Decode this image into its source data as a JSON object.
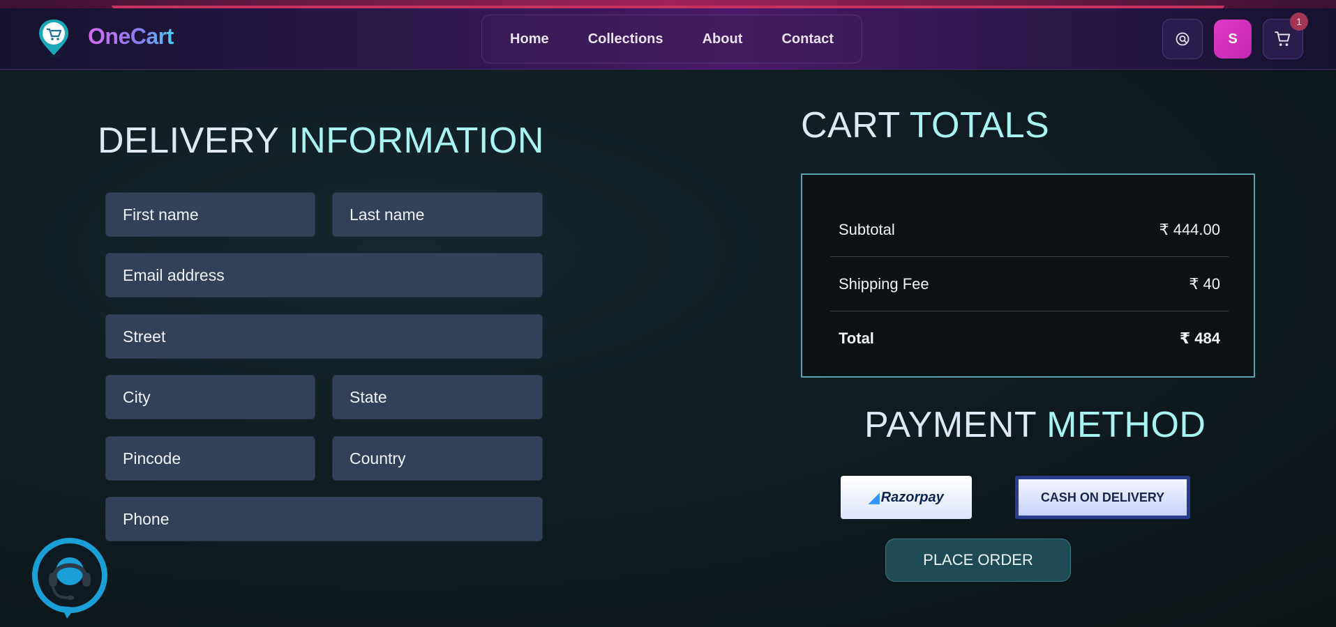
{
  "brand": {
    "name": "OneCart"
  },
  "nav": {
    "items": [
      {
        "label": "Home"
      },
      {
        "label": "Collections"
      },
      {
        "label": "About"
      },
      {
        "label": "Contact"
      }
    ]
  },
  "header": {
    "avatar_initial": "S",
    "cart_count": "1",
    "icons": {
      "search": "search-icon",
      "cart": "cart-icon"
    }
  },
  "delivery": {
    "title_part1": "DELIVERY",
    "title_part2": "INFORMATION",
    "fields": {
      "first_name": "First name",
      "last_name": "Last name",
      "email": "Email address",
      "street": "Street",
      "city": "City",
      "state": "State",
      "pincode": "Pincode",
      "country": "Country",
      "phone": "Phone"
    }
  },
  "cart_totals": {
    "title_part1": "CART",
    "title_part2": "TOTALS",
    "subtotal_label": "Subtotal",
    "subtotal_value": "₹ 444.00",
    "shipping_label": "Shipping Fee",
    "shipping_value": "₹ 40",
    "total_label": "Total",
    "total_value": "₹ 484"
  },
  "payment": {
    "title_part1": "PAYMENT",
    "title_part2": "METHOD",
    "razorpay_label": "Razorpay",
    "cod_label": "CASH ON DELIVERY",
    "selected": "cod",
    "place_order_label": "PLACE ORDER"
  },
  "colors": {
    "accent": "#a8f4f2",
    "field_bg": "#324157",
    "header_purple": "#4a1a6a",
    "avatar_pink": "#e33bc7"
  }
}
